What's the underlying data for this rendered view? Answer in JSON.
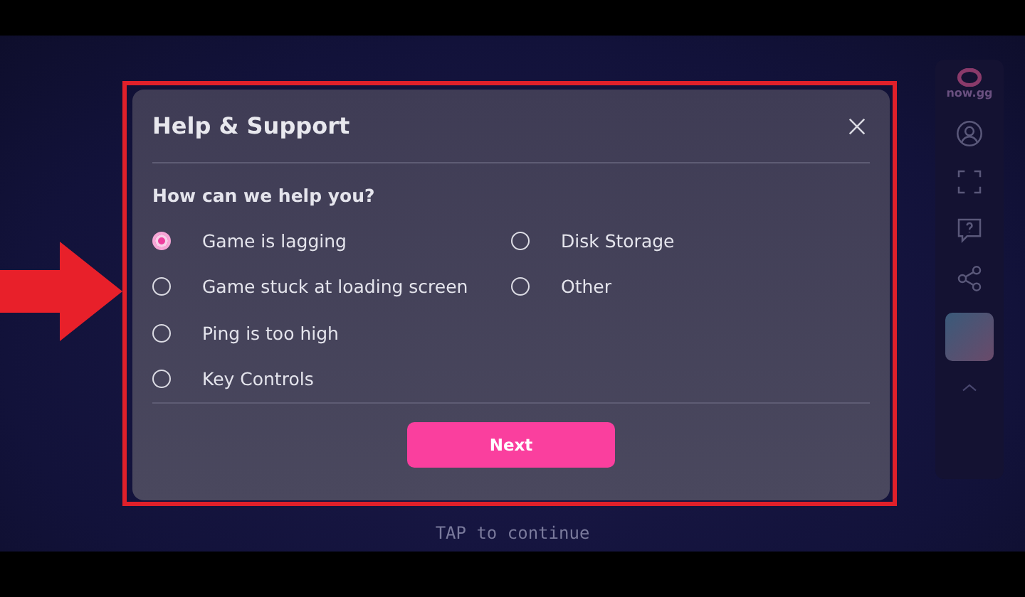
{
  "background": {
    "hint": "TAP to continue"
  },
  "sidebar": {
    "logo": "now.gg"
  },
  "dialog": {
    "title": "Help & Support",
    "question": "How can we help you?",
    "option_columns": [
      [
        {
          "label": "Game is lagging",
          "selected": true
        },
        {
          "label": "Game stuck at loading screen",
          "selected": false
        },
        {
          "label": "Ping is too high",
          "selected": false
        },
        {
          "label": "Key Controls",
          "selected": false
        }
      ],
      [
        {
          "label": "Disk Storage",
          "selected": false
        },
        {
          "label": "Other",
          "selected": false
        }
      ]
    ],
    "button": "Next"
  }
}
